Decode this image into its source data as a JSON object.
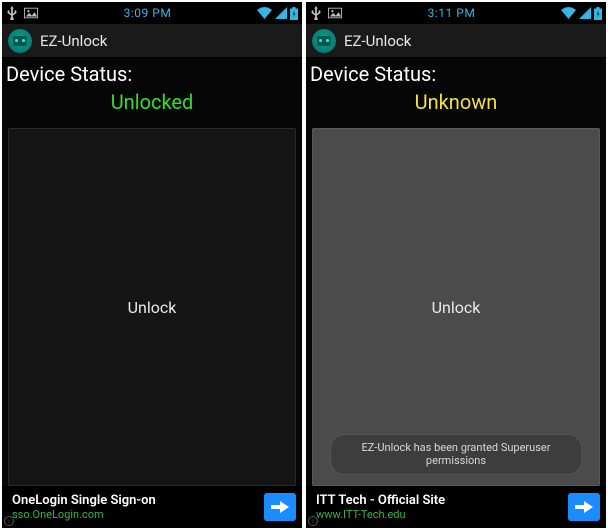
{
  "screens": [
    {
      "status_bar": {
        "time": "3:09 PM"
      },
      "app": {
        "title": "EZ-Unlock"
      },
      "device_status": {
        "label": "Device Status:",
        "value": "Unlocked",
        "class": "status-unlocked"
      },
      "unlock_button": "Unlock",
      "toast": null,
      "ad": {
        "title": "OneLogin Single Sign-on",
        "sub": "sso.OneLogin.com"
      }
    },
    {
      "status_bar": {
        "time": "3:11 PM"
      },
      "app": {
        "title": "EZ-Unlock"
      },
      "device_status": {
        "label": "Device Status:",
        "value": "Unknown",
        "class": "status-unknown"
      },
      "unlock_button": "Unlock",
      "toast": "EZ-Unlock has been granted Superuser permissions",
      "ad": {
        "title": "ITT Tech - Official Site",
        "sub": "www.ITT-Tech.edu"
      }
    }
  ],
  "colors": {
    "holo_blue": "#33b5e5",
    "ad_blue": "#1a8cff",
    "ad_green": "#3bb24a"
  }
}
